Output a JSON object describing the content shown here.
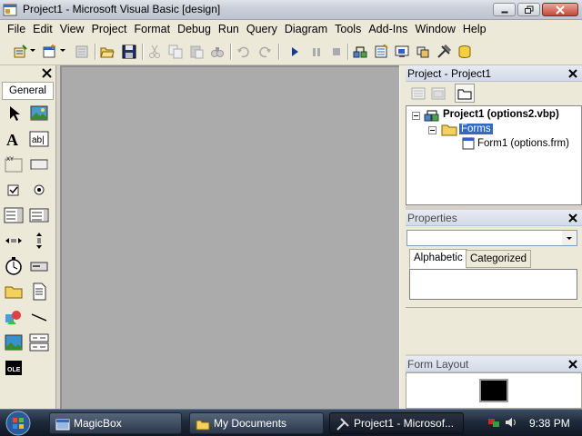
{
  "window": {
    "title": "Project1 - Microsoft Visual Basic [design]",
    "controls": [
      "minimize-icon",
      "maximize-icon",
      "close-icon"
    ]
  },
  "menu": {
    "items": [
      "File",
      "Edit",
      "View",
      "Project",
      "Format",
      "Debug",
      "Run",
      "Query",
      "Diagram",
      "Tools",
      "Add-Ins",
      "Window",
      "Help"
    ]
  },
  "toolbar": {
    "icons": [
      "add-project-icon",
      "add-form-icon",
      "menu-editor-icon",
      "open-icon",
      "save-icon",
      "cut-icon",
      "copy-icon",
      "paste-icon",
      "find-icon",
      "undo-icon",
      "redo-icon",
      "start-icon",
      "break-icon",
      "end-icon",
      "project-explorer-icon",
      "properties-icon",
      "form-layout-icon",
      "object-browser-icon",
      "toolbox-icon",
      "data-view-icon"
    ]
  },
  "toolbox": {
    "tab_label": "General",
    "tools": [
      "pointer-icon",
      "picturebox-icon",
      "label-icon",
      "textbox-icon",
      "frame-icon",
      "commandbutton-icon",
      "checkbox-icon",
      "optionbutton-icon",
      "combobox-icon",
      "listbox-icon",
      "hscrollbar-icon",
      "vscrollbar-icon",
      "timer-icon",
      "drivelistbox-icon",
      "dirlistbox-icon",
      "filelistbox-icon",
      "shape-icon",
      "line-icon",
      "image-icon",
      "data-icon",
      "ole-icon"
    ]
  },
  "project_panel": {
    "title": "Project - Project1",
    "tree": {
      "root": "Project1 (options2.vbp)",
      "folder": "Forms",
      "form": "Form1 (options.frm)"
    }
  },
  "properties_panel": {
    "title": "Properties",
    "combo_value": "",
    "tabs": [
      "Alphabetic",
      "Categorized"
    ],
    "active_tab": "Alphabetic"
  },
  "form_layout_panel": {
    "title": "Form Layout"
  },
  "taskbar": {
    "buttons": [
      "MagicBox",
      "My Documents",
      "Project1 - Microsof..."
    ],
    "active_button": "Project1 - Microsof...",
    "clock": "9:38 PM"
  },
  "colors": {
    "workspace": "#ababab",
    "selection": "#316ac5",
    "taskbar": "#1f2b3b"
  }
}
